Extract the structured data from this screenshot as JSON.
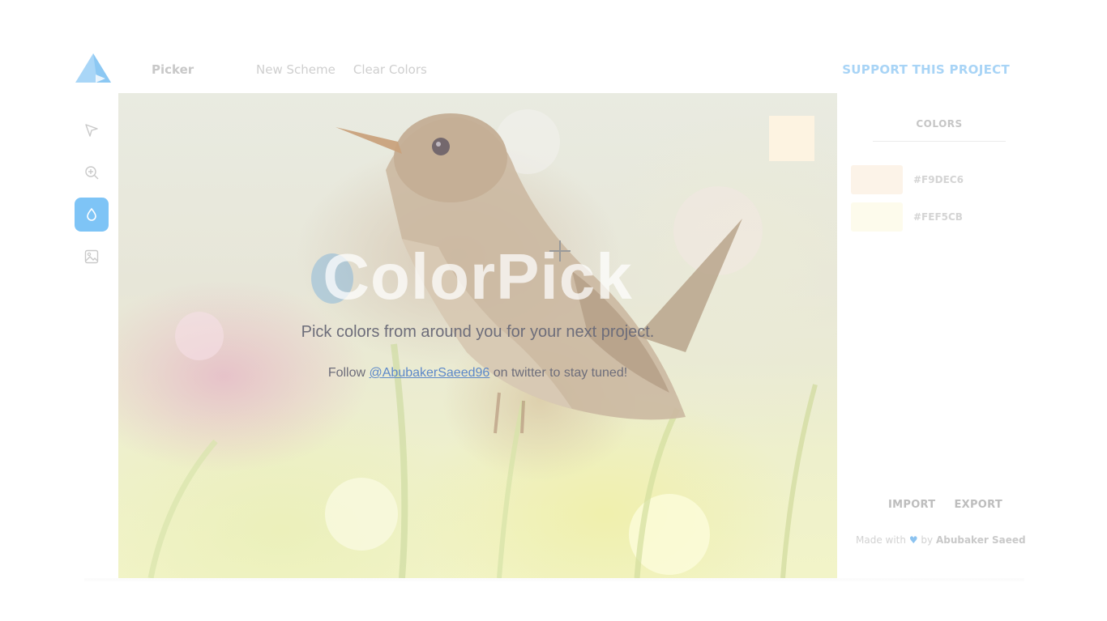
{
  "header": {
    "title": "Picker",
    "nav": [
      "New Scheme",
      "Clear Colors"
    ],
    "support": "SUPPORT THIS PROJECT"
  },
  "tools": [
    {
      "icon": "cursor-icon",
      "active": false
    },
    {
      "icon": "zoom-in-icon",
      "active": false
    },
    {
      "icon": "droplet-icon",
      "active": true
    },
    {
      "icon": "image-icon",
      "active": false
    }
  ],
  "canvas": {
    "brand": "ColorPick",
    "tagline": "Pick colors from around you for your next project.",
    "follow_prefix": "Follow ",
    "follow_handle": "@AbubakerSaeed96",
    "follow_suffix": " on twitter to stay tuned!",
    "preview_color": "#FDF3E1"
  },
  "panel": {
    "heading": "COLORS",
    "colors": [
      {
        "code": "#F9DEC6",
        "swatch": "#FCF3E8"
      },
      {
        "code": "#FEF5CB",
        "swatch": "#FDFBEC"
      }
    ],
    "import_label": "IMPORT",
    "export_label": "EXPORT",
    "credit_prefix": "Made with",
    "credit_by": "by",
    "credit_author": "Abubaker Saeed"
  },
  "accent": "#7EC4F6"
}
